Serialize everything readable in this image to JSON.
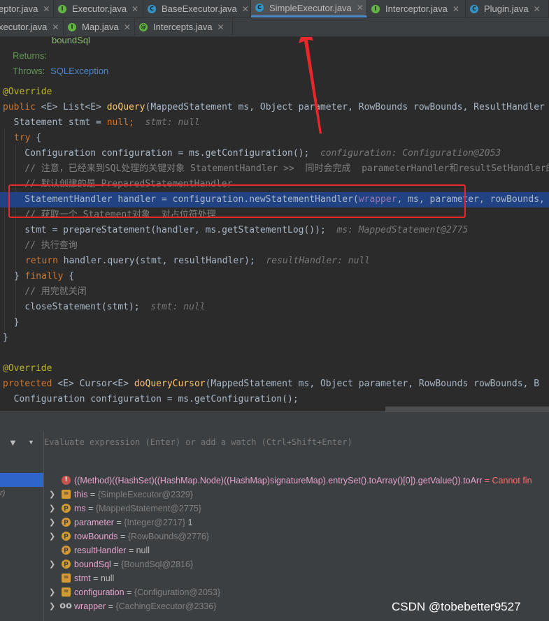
{
  "tabs_row1": [
    {
      "label": "eptor.java",
      "icon": "I",
      "active": false
    },
    {
      "label": "Executor.java",
      "icon": "I",
      "active": false
    },
    {
      "label": "BaseExecutor.java",
      "icon": "A",
      "active": false
    },
    {
      "label": "SimpleExecutor.java",
      "icon": "C",
      "active": true
    },
    {
      "label": "Interceptor.java",
      "icon": "I",
      "active": false
    },
    {
      "label": "Plugin.java",
      "icon": "C",
      "active": false
    }
  ],
  "tabs_row2": [
    {
      "label": "xecutor.java",
      "icon": "",
      "active": false
    },
    {
      "label": "Map.java",
      "icon": "I",
      "active": false
    },
    {
      "label": "Intercepts.java",
      "icon": "@",
      "active": false
    }
  ],
  "code": {
    "l0": "boundSql",
    "l1": "Returns:",
    "l2a": "Throws:",
    "l2b": "SQLException",
    "l3": "@Override",
    "l4a": "public",
    "l4b": " <E> List<E> ",
    "l4c": "doQuery",
    "l4d": "(MappedStatement ms, Object parameter, RowBounds rowBounds, ResultHandler",
    "l5a": "  Statement stmt = ",
    "l5b": "null",
    "l5c": ";",
    "l5d": "stmt: null",
    "l6a": "try",
    "l6b": " {",
    "l7a": "    Configuration configuration = ms.getConfiguration();",
    "l7b": "configuration: Configuration@2053",
    "l8": "    // 注意，已经来到SQL处理的关键对象 StatementHandler >>  同时会完成  parameterHandler和resultSetHandler的",
    "l9": "    // 默认创建的是 PreparedStatementHandler",
    "l10": "    StatementHandler handler = configuration.newStatementHandler(wrapper, ms, parameter, rowBounds,",
    "l11": "    // 获取一个 Statement对象  对占位符处理",
    "l12a": "    stmt = prepareStatement(handler, ms.getStatementLog());",
    "l12b": "ms: MappedStatement@2775",
    "l13": "    // 执行查询",
    "l14a": "return",
    "l14b": " handler.query(stmt, resultHandler);",
    "l14c": "resultHandler: null",
    "l15a": "} ",
    "l15b": "finally",
    "l15c": " {",
    "l16": "    // 用完就关闭",
    "l17a": "    closeStatement(stmt);",
    "l17b": "stmt: null",
    "l18": "  }",
    "l19": "}",
    "l20": "@Override",
    "l21a": "protected",
    "l21b": " <E> Cursor<E> ",
    "l21c": "doQueryCursor",
    "l21d": "(MappedStatement ms, Object parameter, RowBounds rowBounds, B",
    "l22": "  Configuration configuration = ms.getConfiguration();"
  },
  "debugger": {
    "watch_placeholder": "Evaluate expression (Enter) or add a watch (Ctrl+Shift+Enter)",
    "frame_hint": "r)",
    "error_row": {
      "expr": "((Method)((HashSet)((HashMap.Node)((HashMap)signatureMap).entrySet().toArray()[0]).getValue()).toArr",
      "msg": "= Cannot fin"
    },
    "variables": [
      {
        "name": "this",
        "type": "{SimpleExecutor@2329}",
        "value": "",
        "expandable": true,
        "icon": "=",
        "icon_style": "sq"
      },
      {
        "name": "ms",
        "type": "{MappedStatement@2775}",
        "value": "",
        "expandable": true,
        "icon": "p",
        "icon_style": "round"
      },
      {
        "name": "parameter",
        "type": "{Integer@2717}",
        "value": "1",
        "expandable": true,
        "icon": "p",
        "icon_style": "round"
      },
      {
        "name": "rowBounds",
        "type": "{RowBounds@2776}",
        "value": "",
        "expandable": true,
        "icon": "p",
        "icon_style": "round"
      },
      {
        "name": "resultHandler",
        "type": "",
        "value": "null",
        "expandable": false,
        "icon": "p",
        "icon_style": "round"
      },
      {
        "name": "boundSql",
        "type": "{BoundSql@2816}",
        "value": "",
        "expandable": true,
        "icon": "p",
        "icon_style": "round"
      },
      {
        "name": "stmt",
        "type": "",
        "value": "null",
        "expandable": false,
        "icon": "=",
        "icon_style": "sq"
      },
      {
        "name": "configuration",
        "type": "{Configuration@2053}",
        "value": "",
        "expandable": true,
        "icon": "=",
        "icon_style": "sq"
      },
      {
        "name": "wrapper",
        "type": "{CachingExecutor@2336}",
        "value": "",
        "expandable": true,
        "icon": "oo",
        "icon_style": "inf"
      }
    ]
  },
  "watermark": "CSDN @tobebetter9527",
  "colors": {
    "highlight": "#214283",
    "annotation_red": "#e8272b",
    "keyword": "#cc7832",
    "function": "#ffc66d"
  }
}
